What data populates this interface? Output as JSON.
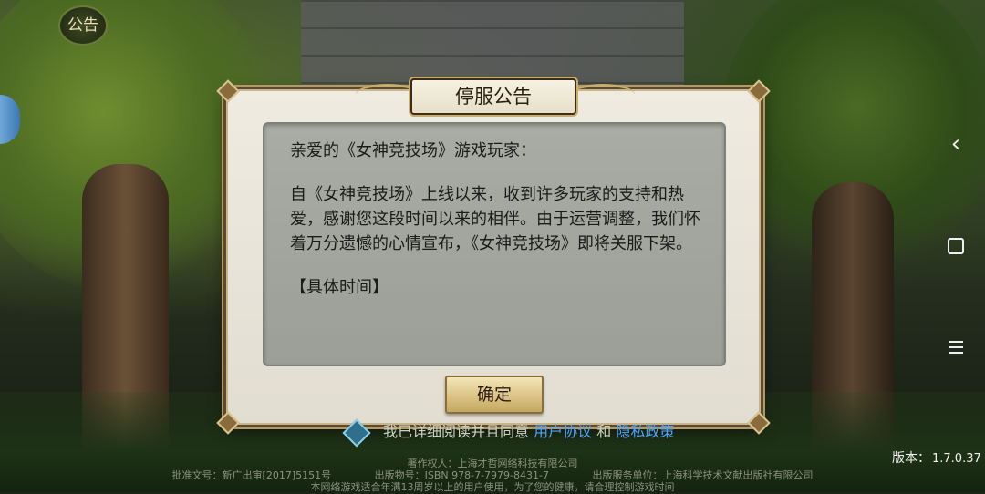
{
  "hud": {
    "notice_badge": "公告",
    "version_label": "版本：",
    "version_value": "1.7.0.37"
  },
  "nav": {
    "back_icon": "chevron-left-icon",
    "home_icon": "square-icon",
    "menu_icon": "hamburger-icon"
  },
  "dialog": {
    "title": "停服公告",
    "greeting": "亲爱的《女神竞技场》游戏玩家：",
    "body": "自《女神竞技场》上线以来，收到许多玩家的支持和热爱，感谢您这段时间以来的相伴。由于运营调整，我们怀着万分遗憾的心情宣布，《女神竞技场》即将关服下架。",
    "section": "【具体时间】",
    "confirm_label": "确定"
  },
  "agreement": {
    "prefix": "我已详细阅读并且同意",
    "user_agreement": "用户协议",
    "and": "和",
    "privacy_policy": "隐私政策"
  },
  "legal": {
    "copyright": "著作权人：上海才哲网络科技有限公司",
    "approval": "批准文号：新广出审[2017]5151号",
    "isbn": "出版物号：ISBN 978-7-7979-8431-7",
    "publisher": "出版服务单位：上海科学技术文献出版社有限公司",
    "age_notice": "本网络游戏适合年满13周岁以上的用户使用，为了您的健康，请合理控制游戏时间"
  }
}
